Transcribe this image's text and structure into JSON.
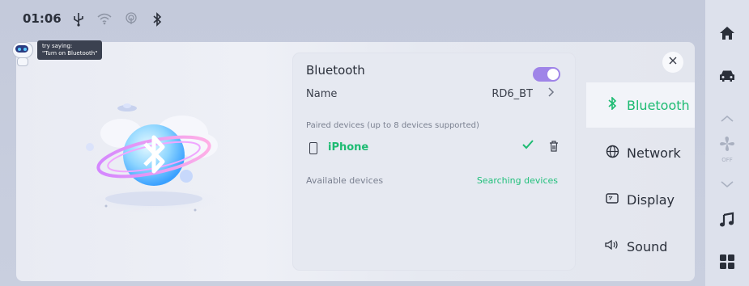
{
  "status_bar": {
    "time": "01:06",
    "icons": [
      "usb-icon",
      "wifi-icon",
      "hotspot-icon",
      "bluetooth-icon"
    ]
  },
  "voice_hint": {
    "line1": "try saying:",
    "line2": "\"Turn on Bluetooth\""
  },
  "bluetooth_card": {
    "title": "Bluetooth",
    "toggle_on": true,
    "name_label": "Name",
    "name_value": "RD6_BT",
    "paired_label": "Paired devices (up to 8 devices supported)",
    "paired_devices": [
      {
        "name": "iPhone",
        "connected": true
      }
    ],
    "available_label": "Available devices",
    "searching_text": "Searching devices"
  },
  "side_menu": {
    "items": [
      {
        "label": "Bluetooth",
        "icon": "bluetooth-icon",
        "active": true
      },
      {
        "label": "Network",
        "icon": "globe-icon",
        "active": false
      },
      {
        "label": "Display",
        "icon": "display-icon",
        "active": false
      },
      {
        "label": "Sound",
        "icon": "speaker-icon",
        "active": false
      }
    ]
  },
  "dock": {
    "items": [
      "home-icon",
      "car-icon",
      "chevron-up-icon",
      "fan-icon",
      "chevron-down-icon",
      "music-icon",
      "apps-icon"
    ],
    "fan_status": "OFF"
  },
  "colors": {
    "accent_green": "#1dbb72",
    "toggle_purple": "#9f84e8"
  }
}
